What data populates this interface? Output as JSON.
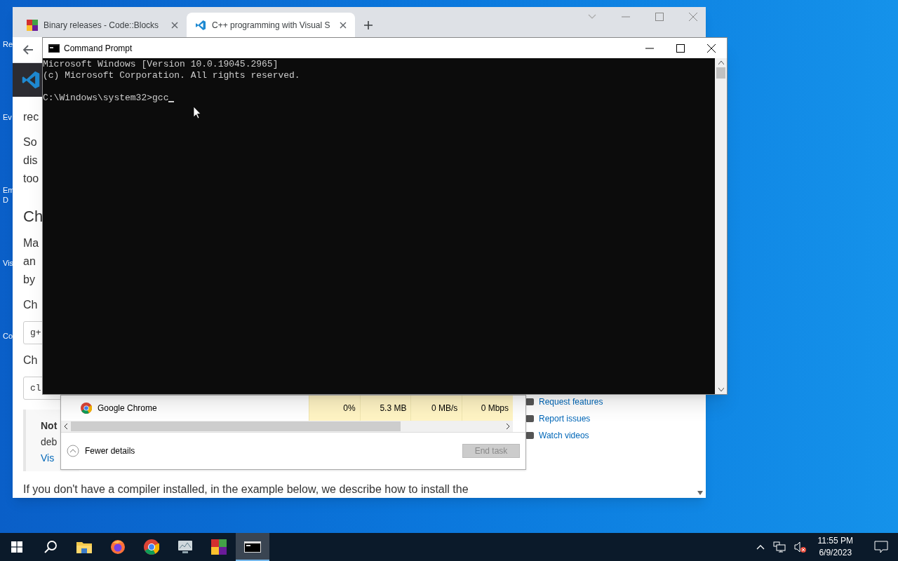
{
  "desktop": {
    "icon_labels": [
      "Re",
      "Ev",
      "Em",
      "D",
      "Vis",
      "Co"
    ]
  },
  "browser": {
    "tabs": [
      {
        "title": "Binary releases - Code::Blocks",
        "selected": false
      },
      {
        "title": "C++ programming with Visual S",
        "selected": true
      }
    ],
    "page": {
      "blocks": [
        {
          "kind": "paragraph",
          "lines": [
            "rec"
          ]
        },
        {
          "kind": "paragraph",
          "lines": [
            "So",
            "dis",
            "too"
          ]
        },
        {
          "kind": "heading",
          "lines": [
            "Ch"
          ]
        },
        {
          "kind": "paragraph",
          "lines": [
            "Ma",
            "an",
            "by"
          ]
        },
        {
          "kind": "paragraph",
          "lines": [
            "Ch"
          ]
        },
        {
          "kind": "code",
          "lines": [
            "g+"
          ]
        },
        {
          "kind": "paragraph",
          "lines": [
            "Ch"
          ]
        },
        {
          "kind": "code",
          "lines": [
            "cl"
          ]
        },
        {
          "kind": "note",
          "title": "Not",
          "lines": [
            "deb"
          ],
          "link": "Vis"
        }
      ],
      "side_links": [
        "Request features",
        "Report issues",
        "Watch videos"
      ],
      "bottom_text": "If you don't have a compiler installed, in the example below, we describe how to install the"
    }
  },
  "task_manager": {
    "rows": [
      {
        "name": "Google Chrome",
        "cpu": "0%",
        "memory": "5.3 MB",
        "disk": "0 MB/s",
        "network": "0 Mbps"
      }
    ],
    "fewer_details": "Fewer details",
    "end_task": {
      "label": "End task",
      "disabled": true
    }
  },
  "command_prompt": {
    "title": "Command Prompt",
    "output": [
      "Microsoft Windows [Version 10.0.19045.2965]",
      "(c) Microsoft Corporation. All rights reserved."
    ],
    "prompt": "C:\\Windows\\system32>gcc"
  },
  "taskbar": {
    "apps": [
      {
        "kind": "start",
        "active": false
      },
      {
        "kind": "search",
        "active": false
      },
      {
        "kind": "explorer",
        "active": false
      },
      {
        "kind": "firefox",
        "active": false
      },
      {
        "kind": "chrome",
        "active": false
      },
      {
        "kind": "monitor",
        "active": false
      },
      {
        "kind": "codeblocks",
        "active": false
      },
      {
        "kind": "cmd",
        "active": true
      }
    ],
    "time": "11:55 PM",
    "date": "6/9/2023"
  }
}
